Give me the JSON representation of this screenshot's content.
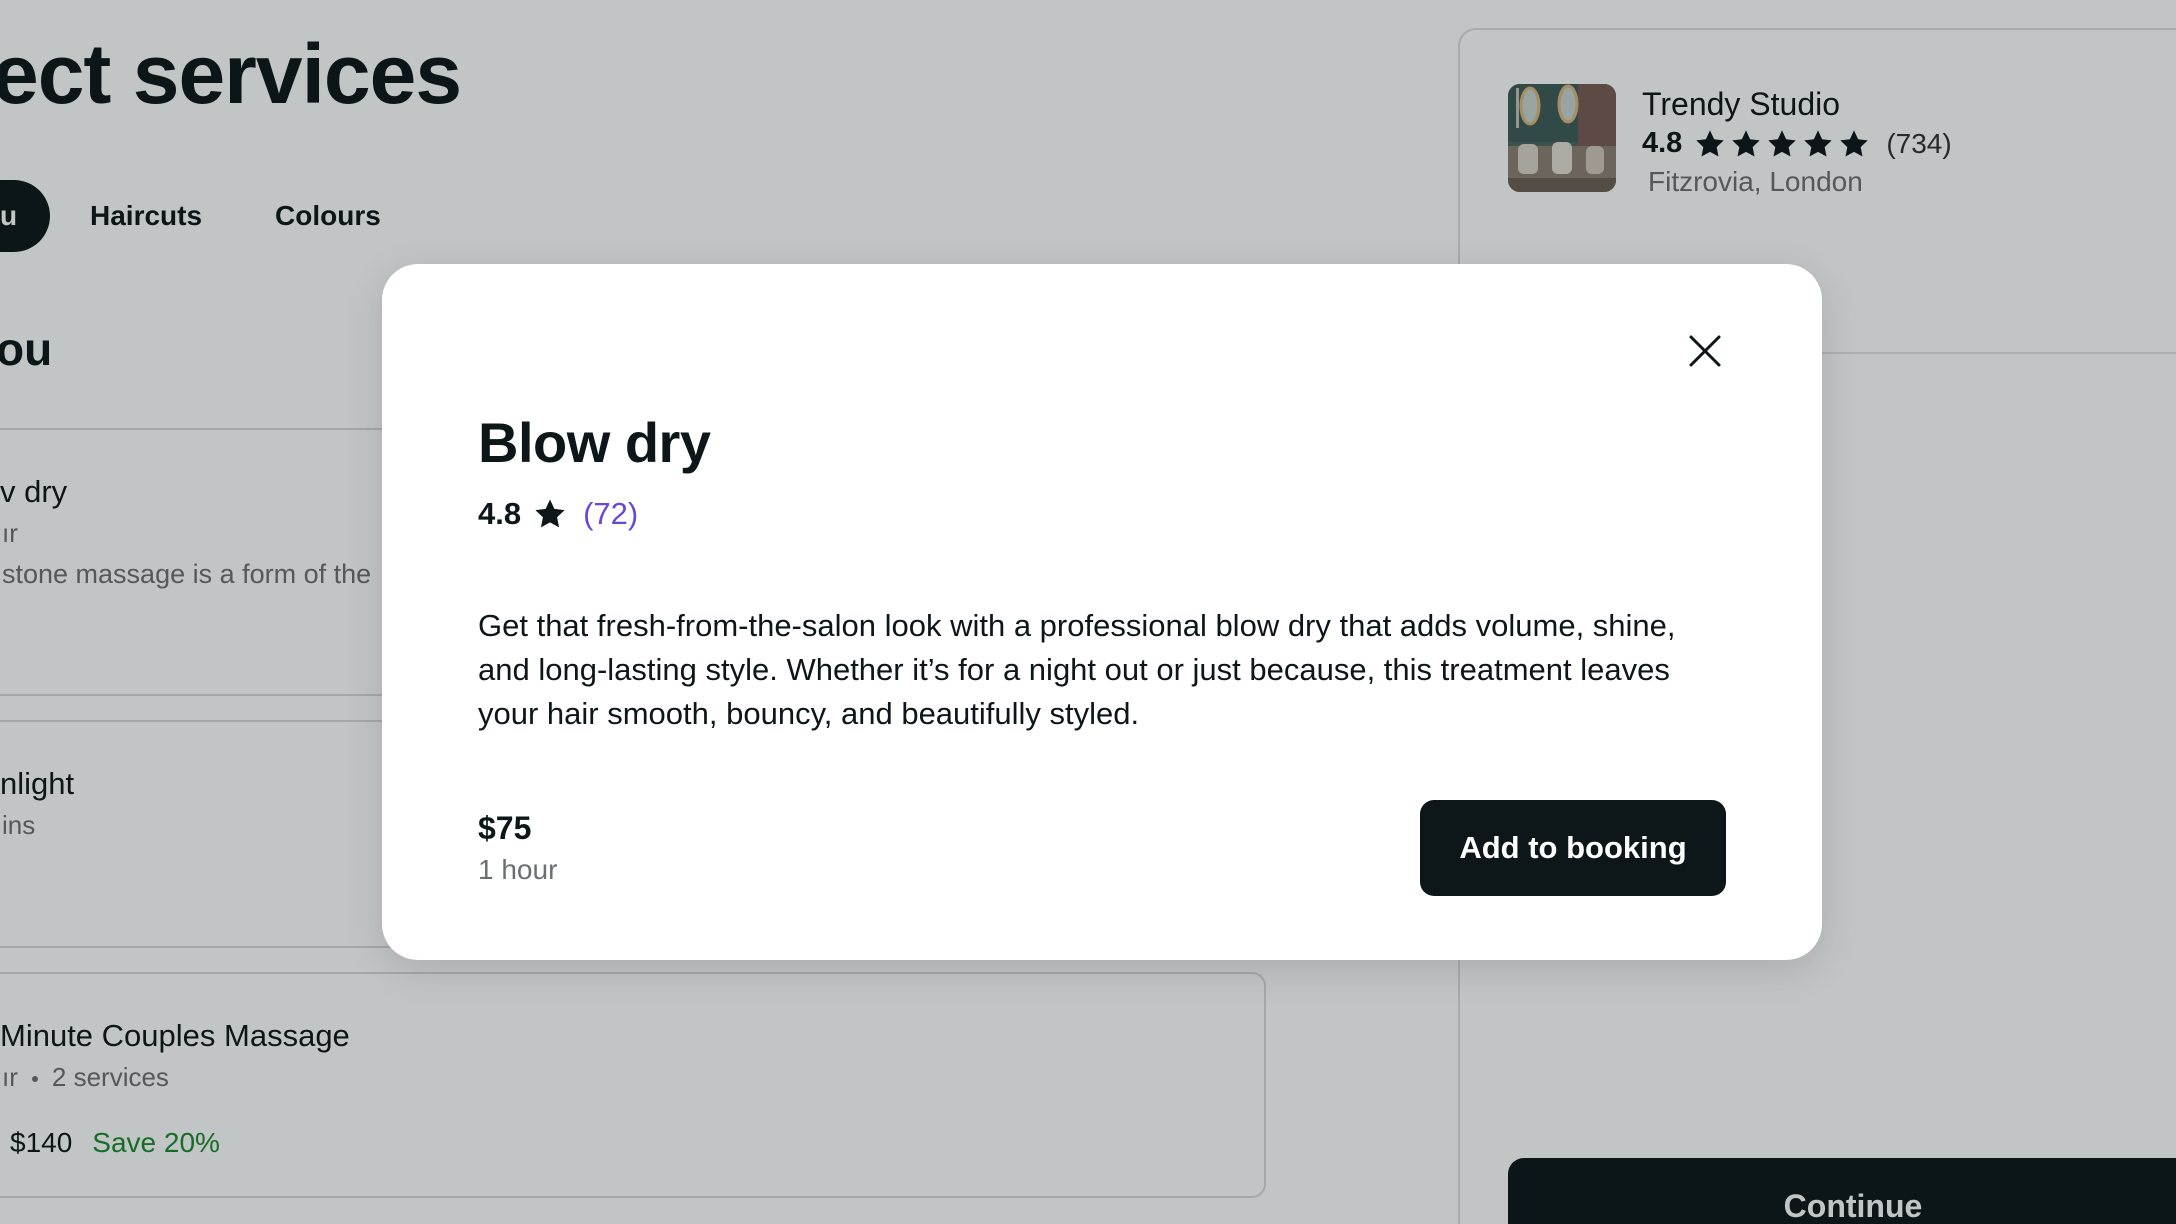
{
  "page": {
    "title": "ect services",
    "section_heading": "ou"
  },
  "categories": {
    "active_fragment": "u",
    "tabs": [
      {
        "label": "Haircuts"
      },
      {
        "label": "Colours"
      }
    ]
  },
  "services": [
    {
      "name": "v dry",
      "meta": "ır",
      "description": "stone massage is a form of the"
    },
    {
      "name": "nlight",
      "meta": "ins"
    },
    {
      "name": "Minute Couples Massage",
      "meta_duration": "ır",
      "meta_services": "2 services",
      "price": "$140",
      "save": "Save 20%"
    }
  ],
  "booking_panel": {
    "venue_name": "Trendy Studio",
    "venue_rating": "4.8",
    "venue_stars": 5,
    "venue_review_count": "(734)",
    "venue_location": "Fitzrovia, London",
    "continue_label": "Continue"
  },
  "modal": {
    "title": "Blow dry",
    "rating": "4.8",
    "review_count": "(72)",
    "description": "Get that fresh-from-the-salon look with a professional blow dry that adds volume, shine, and long-lasting style. Whether it’s for a night out or just because, this treatment leaves your hair smooth, bouncy, and beautifully styled.",
    "price": "$75",
    "duration": "1 hour",
    "add_button_label": "Add to booking",
    "close_icon": "close-icon"
  },
  "colors": {
    "primary": "#0d1619",
    "accent_link": "#6a48d7",
    "save_green": "#1b8a2d",
    "muted_text": "#6b6f72",
    "overlay": "rgba(13,22,25,0.25)"
  }
}
